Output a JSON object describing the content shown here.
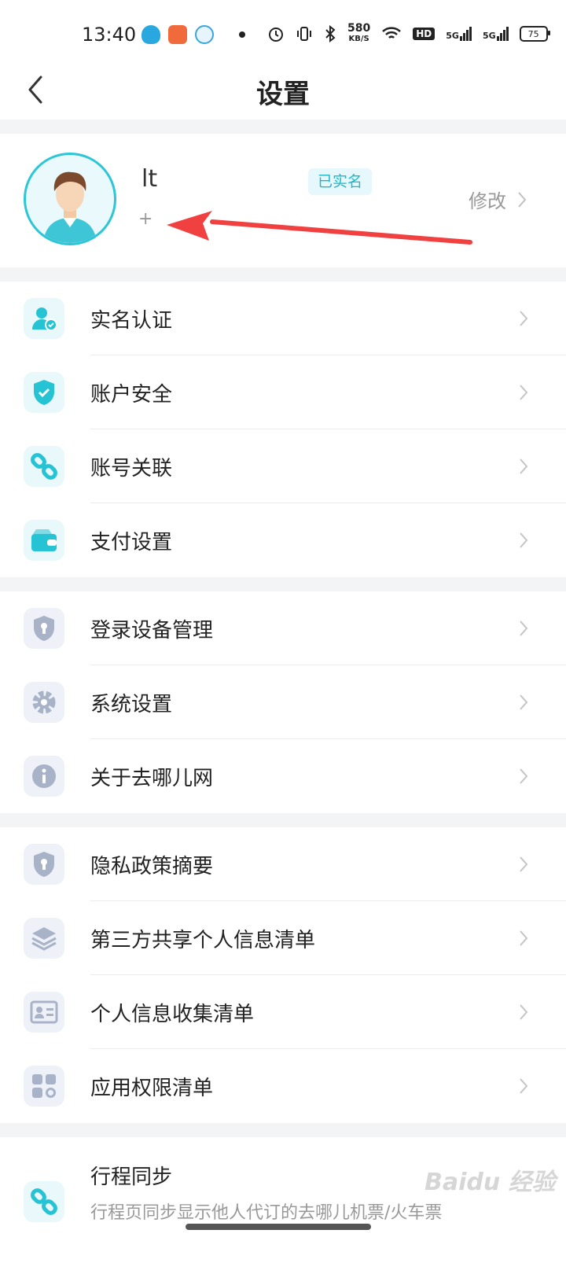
{
  "status_bar": {
    "time": "13:40",
    "net_speed_value": "580",
    "net_speed_unit": "KB/S",
    "hd_label": "HD",
    "signal_1": "5G",
    "signal_2": "5G",
    "battery": "75"
  },
  "header": {
    "title": "设置"
  },
  "profile": {
    "username": "lt",
    "verified_badge": "已实名",
    "uid_placeholder": "+",
    "edit_label": "修改"
  },
  "group1": [
    {
      "label": "实名认证",
      "icon": "id-verify-icon"
    },
    {
      "label": "账户安全",
      "icon": "shield-check-icon"
    },
    {
      "label": "账号关联",
      "icon": "link-icon"
    },
    {
      "label": "支付设置",
      "icon": "wallet-icon"
    }
  ],
  "group2": [
    {
      "label": "登录设备管理",
      "icon": "device-lock-icon"
    },
    {
      "label": "系统设置",
      "icon": "gear-icon"
    },
    {
      "label": "关于去哪儿网",
      "icon": "info-icon"
    }
  ],
  "group3": [
    {
      "label": "隐私政策摘要",
      "icon": "privacy-shield-icon"
    },
    {
      "label": "第三方共享个人信息清单",
      "icon": "layers-icon"
    },
    {
      "label": "个人信息收集清单",
      "icon": "id-card-icon"
    },
    {
      "label": "应用权限清单",
      "icon": "apps-grid-icon"
    }
  ],
  "trip_sync": {
    "title": "行程同步",
    "description": "行程页同步显示他人代订的去哪儿机票/火车票"
  },
  "watermark": "Baidu 经验",
  "colors": {
    "accent": "#1fb7c9",
    "teal_icon": "#25c3d3",
    "grey_icon": "#a9b3c8",
    "annotation_arrow": "#f04040"
  }
}
